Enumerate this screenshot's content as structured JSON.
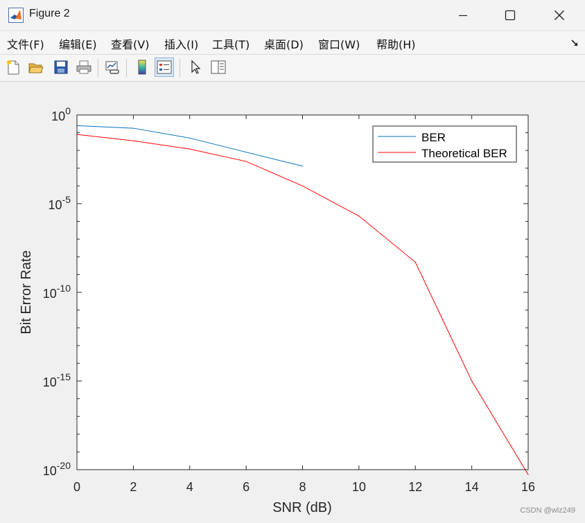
{
  "window": {
    "title": "Figure 2",
    "minimize_glyph": "—",
    "maximize_glyph": "☐",
    "close_glyph": "✕"
  },
  "menu": {
    "items": [
      "文件(F)",
      "编辑(E)",
      "查看(V)",
      "插入(I)",
      "工具(T)",
      "桌面(D)",
      "窗口(W)",
      "帮助(H)"
    ]
  },
  "toolbar": {
    "buttons": [
      "new-figure-icon",
      "open-file-icon",
      "save-icon",
      "print-icon",
      "link-icon",
      "colorbar-icon",
      "legend-icon",
      "pointer-icon",
      "property-editor-icon"
    ],
    "active": "legend-icon"
  },
  "chart_data": {
    "type": "line",
    "title": "",
    "xlabel": "SNR (dB)",
    "ylabel": "Bit Error Rate",
    "xlim": [
      0,
      16
    ],
    "ylim": [
      1e-20,
      1
    ],
    "yscale": "log",
    "xticks": [
      "0",
      "2",
      "4",
      "6",
      "8",
      "10",
      "12",
      "14",
      "16"
    ],
    "yticks": [
      {
        "base": "10",
        "exp": "0"
      },
      {
        "base": "10",
        "exp": "-5"
      },
      {
        "base": "10",
        "exp": "-10"
      },
      {
        "base": "10",
        "exp": "-15"
      },
      {
        "base": "10",
        "exp": "-20"
      }
    ],
    "grid": false,
    "legend_position": "top-right",
    "series": [
      {
        "name": "BER",
        "color": "#0072bd",
        "x": [
          0,
          2,
          4,
          6,
          8
        ],
        "y": [
          0.25,
          0.18,
          0.05,
          0.008,
          0.0013
        ]
      },
      {
        "name": "Theoretical BER",
        "color": "#ff0000",
        "x": [
          0,
          2,
          4,
          6,
          8,
          10,
          12,
          14,
          16
        ],
        "y": [
          0.08,
          0.035,
          0.012,
          0.0024,
          0.0001,
          2e-06,
          5e-09,
          1e-15,
          5.3e-21
        ]
      }
    ]
  },
  "watermark": "CSDN @wlz249"
}
